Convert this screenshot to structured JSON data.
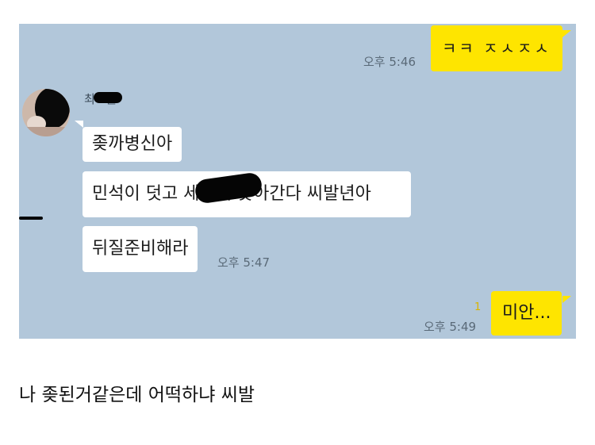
{
  "chat": {
    "background": "#b2c7da",
    "sent_color": "#fee500",
    "received_color": "#ffffff",
    "messages": {
      "sent_1": {
        "text": "ㅋㅋ ㅈㅅㅈㅅ",
        "time": "오후 5:46"
      },
      "received_sender": "최ㅇ준",
      "received_1": {
        "text": "좆까병신아"
      },
      "received_2": {
        "text": "민석이 덧고 세ㅇ에 찾아간다 씨발년아"
      },
      "received_3": {
        "text": "뒤질준비해라",
        "time": "오후 5:47"
      },
      "sent_2": {
        "text": "미안...",
        "time": "오후 5:49",
        "unread": "1"
      }
    }
  },
  "caption": "나 좆된거같은데 어떡하냐 씨발"
}
